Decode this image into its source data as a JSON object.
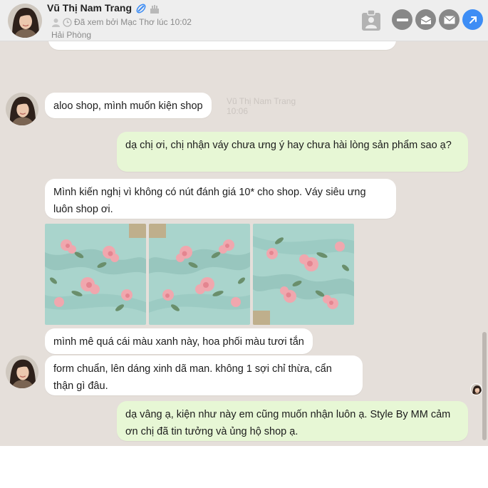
{
  "contact": {
    "name": "Vũ Thị Nam Trang",
    "seen_status": "Đã xem bởi Mạc Thơ lúc 10:02",
    "location": "Hải Phòng"
  },
  "header_icons": [
    "verified-badge-icon",
    "birthday-cake-icon",
    "clipboard-user-icon",
    "minus-icon",
    "mail-icon",
    "envelope-icon",
    "open-external-icon"
  ],
  "colors": {
    "chat_background": "#e5dfda",
    "incoming_bubble": "#ffffff",
    "outgoing_bubble": "#e7f7d5",
    "action_gray": "#888888",
    "action_blue": "#3d8df5"
  },
  "messages": [
    {
      "side": "in",
      "text": "aloo shop, mình muốn kiện shop"
    },
    {
      "side": "out",
      "text": "dạ chị ơi, chị nhận váy chưa ưng ý hay chưa hài lòng sản phẩm sao ạ?"
    },
    {
      "side": "in",
      "text": "Mình kiến nghị vì không có nút đánh giá 10* cho shop. Váy siêu ưng luôn shop ơi."
    },
    {
      "side": "in",
      "text": "mình mê quá cái màu xanh này, hoa phối màu tươi tắn"
    },
    {
      "side": "in",
      "text": "form chuẩn, lên dáng xinh dã man. không 1 sợi chỉ thừa, cẩn thận gì đâu."
    },
    {
      "side": "out",
      "text": "dạ vâng ạ, kiện như này em cũng muốn nhận luôn ạ. Style By MM cảm ơn chị đã tin tưởng và ủng hộ shop ạ."
    }
  ],
  "ghost_stamp": {
    "name": "Vũ Thị Nam Trang",
    "time": "10:06"
  },
  "photos": [
    "floral-dress-photo-1",
    "floral-dress-photo-2",
    "floral-dress-photo-3"
  ]
}
